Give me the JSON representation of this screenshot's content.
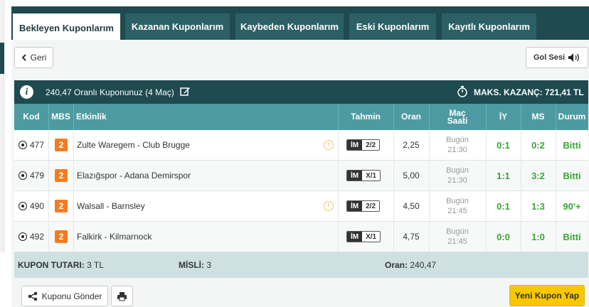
{
  "tabs": [
    {
      "label": "Bekleyen Kuponlarım",
      "active": true
    },
    {
      "label": "Kazanan Kuponlarım",
      "active": false
    },
    {
      "label": "Kaybeden Kuponlarım",
      "active": false
    },
    {
      "label": "Eski Kuponlarım",
      "active": false
    },
    {
      "label": "Kayıtlı Kuponlarım",
      "active": false
    }
  ],
  "back_button": {
    "label": "Geri",
    "icon": "chevron-left-icon"
  },
  "goal_sound_button": {
    "label": "Gol Sesi",
    "icon": "speaker-icon"
  },
  "info_bar": {
    "info_icon": "i",
    "coupon_summary": "240,47 Oranlı Kuponunuz (4 Maç)",
    "edit_icon": "edit-icon",
    "stopwatch_icon": "stopwatch-icon",
    "max_win": "MAKS. KAZANÇ: 721,41 TL"
  },
  "table": {
    "headers": {
      "kod": "Kod",
      "mbs": "MBS",
      "etkinlik": "Etkinlik",
      "tahmin": "Tahmin",
      "oran": "Oran",
      "mac_saati_1": "Maç",
      "mac_saati_2": "Saati",
      "iy": "İY",
      "ms": "MS",
      "durum": "Durum"
    },
    "rows": [
      {
        "kod": "477",
        "mbs": "2",
        "etkinlik": "Zulte Waregem - Club Brugge",
        "has_live_icon": true,
        "tahmin_type": "İM",
        "tahmin_value": "2/2",
        "oran": "2,25",
        "day": "Bugün",
        "time": "21:30",
        "iy": "0:1",
        "ms": "0:2",
        "durum": "Bitti"
      },
      {
        "kod": "479",
        "mbs": "2",
        "etkinlik": "Elazığspor - Adana Demirspor",
        "has_live_icon": false,
        "tahmin_type": "İM",
        "tahmin_value": "X/1",
        "oran": "5,00",
        "day": "Bugün",
        "time": "21:30",
        "iy": "1:1",
        "ms": "3:2",
        "durum": "Bitti"
      },
      {
        "kod": "490",
        "mbs": "2",
        "etkinlik": "Walsall - Barnsley",
        "has_live_icon": true,
        "tahmin_type": "İM",
        "tahmin_value": "2/2",
        "oran": "4,50",
        "day": "Bugün",
        "time": "21:45",
        "iy": "0:1",
        "ms": "1:3",
        "durum": "90'+"
      },
      {
        "kod": "492",
        "mbs": "2",
        "etkinlik": "Falkirk - Kilmarnock",
        "has_live_icon": false,
        "tahmin_type": "İM",
        "tahmin_value": "X/1",
        "oran": "4,75",
        "day": "Bugün",
        "time": "21:45",
        "iy": "0:0",
        "ms": "1:0",
        "durum": "Bitti"
      }
    ]
  },
  "footer": {
    "kupon_tutari_label": "KUPON TUTARI:",
    "kupon_tutari_value": "3 TL",
    "misli_label": "MİSLİ:",
    "misli_value": "3",
    "oran_label": "Oran:",
    "oran_value": "240,47"
  },
  "actions": {
    "send_label": "Kuponu Gönder",
    "print_icon": "print-icon",
    "new_coupon_label": "Yeni Kupon Yap"
  },
  "colors": {
    "dark_teal": "#1e4a50",
    "header_teal": "#4d9aa2",
    "mbs_orange": "#f47c20",
    "result_green": "#3aa635",
    "new_button_yellow": "#f7c800"
  }
}
